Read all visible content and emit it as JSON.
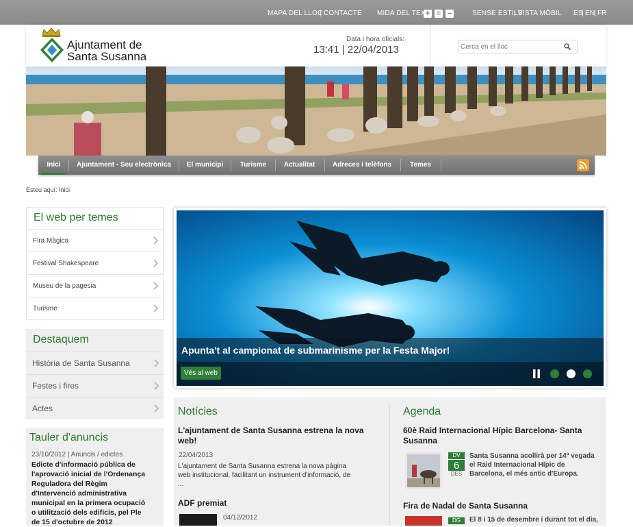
{
  "topbar": {
    "map": "MAPA DEL LLOC",
    "contact": "CONTACTE",
    "text_size": "MIDA DEL TEXT",
    "size_plus": "+",
    "size_eq": "=",
    "size_minus": "−",
    "no_styles": "SENSE ESTILS",
    "mobile": "VISTA MÒBIL",
    "lang_es": "ES",
    "lang_en": "EN",
    "lang_fr": "FR"
  },
  "header": {
    "logo_line1": "Ajuntament de",
    "logo_line2": "Santa Susanna",
    "datetime_label": "Data i hora oficials:",
    "datetime_value": "13:41 | 22/04/2013",
    "search_placeholder": "Cerca en el lloc"
  },
  "nav": {
    "items": [
      "Inici",
      "Ajuntament - Seu electrònica",
      "El municipi",
      "Turisme",
      "Actualitat",
      "Adreces i telèfons",
      "Temes"
    ]
  },
  "breadcrumb": "Esteu aquí: Inici",
  "themes": {
    "title": "El web per temes",
    "items": [
      "Fira Màgica",
      "Festival Shakespeare",
      "Museu de la pagesia",
      "Turisme"
    ]
  },
  "featured": {
    "title": "Destaquem",
    "items": [
      "Història de Santa Susanna",
      "Festes i fires",
      "Actes"
    ]
  },
  "board": {
    "title": "Tauler d'anuncis",
    "meta": "23/10/2012 | Anuncis / edictes",
    "lines": [
      "Edicte d'informació pública de",
      "l'aprovació inicial de l'Ordenança",
      "Reguladora del Règim",
      "d'Intervenció administrativa",
      "municipal en la primera ocupació",
      "o utilització dels edificis, pel Ple",
      "de 15 d'octubre de 2012"
    ]
  },
  "slider": {
    "caption": "Apunta't al campionat de submarinisme per la Festa Major!",
    "button": "Vés al web"
  },
  "news": {
    "title": "Notícies",
    "item1": {
      "headline_l1": "L'ajuntament de Santa Susanna estrena la nova",
      "headline_l2": "web!",
      "date": "22/04/2013",
      "text_l1": "L'ajuntament de Santa Susanna estrena la nova pàgina",
      "text_l2": "web institucional, facilitant un instrument d'informació, de",
      "text_l3": "..."
    },
    "item2": {
      "headline": "ADF premiat",
      "date": "04/12/2012"
    }
  },
  "agenda": {
    "title": "Agenda",
    "item1": {
      "headline_l1": "60è Raid Internacional Hípic Barcelona- Santa",
      "headline_l2": "Susanna",
      "day_name": "DV",
      "day": "6",
      "month": "DES",
      "text_l1": "Santa Susanna acollirà per 14ª vegada",
      "text_l2": "el Raid Internacional Hípic de",
      "text_l3": "Barcelona, el més antic d'Europa."
    },
    "item2": {
      "headline": "Fira de Nadal de Santa Susanna",
      "day_name": "DG",
      "text_l1": "El 8 i 15 de desembre i durant tot el dia,"
    }
  },
  "colors": {
    "brand_green": "#2a7a2e",
    "nav_grey": "#7f7f7f",
    "topbar_grey": "#8f8f8f"
  }
}
